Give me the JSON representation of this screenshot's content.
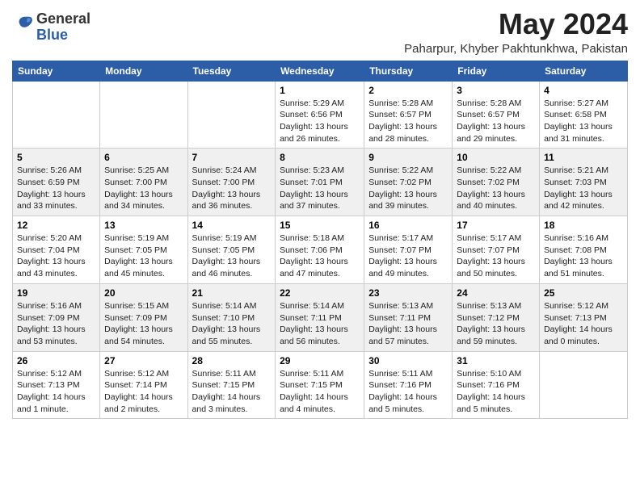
{
  "header": {
    "logo_general": "General",
    "logo_blue": "Blue",
    "month": "May 2024",
    "location": "Paharpur, Khyber Pakhtunkhwa, Pakistan"
  },
  "days_of_week": [
    "Sunday",
    "Monday",
    "Tuesday",
    "Wednesday",
    "Thursday",
    "Friday",
    "Saturday"
  ],
  "weeks": [
    [
      {
        "day": "",
        "info": ""
      },
      {
        "day": "",
        "info": ""
      },
      {
        "day": "",
        "info": ""
      },
      {
        "day": "1",
        "info": "Sunrise: 5:29 AM\nSunset: 6:56 PM\nDaylight: 13 hours\nand 26 minutes."
      },
      {
        "day": "2",
        "info": "Sunrise: 5:28 AM\nSunset: 6:57 PM\nDaylight: 13 hours\nand 28 minutes."
      },
      {
        "day": "3",
        "info": "Sunrise: 5:28 AM\nSunset: 6:57 PM\nDaylight: 13 hours\nand 29 minutes."
      },
      {
        "day": "4",
        "info": "Sunrise: 5:27 AM\nSunset: 6:58 PM\nDaylight: 13 hours\nand 31 minutes."
      }
    ],
    [
      {
        "day": "5",
        "info": "Sunrise: 5:26 AM\nSunset: 6:59 PM\nDaylight: 13 hours\nand 33 minutes."
      },
      {
        "day": "6",
        "info": "Sunrise: 5:25 AM\nSunset: 7:00 PM\nDaylight: 13 hours\nand 34 minutes."
      },
      {
        "day": "7",
        "info": "Sunrise: 5:24 AM\nSunset: 7:00 PM\nDaylight: 13 hours\nand 36 minutes."
      },
      {
        "day": "8",
        "info": "Sunrise: 5:23 AM\nSunset: 7:01 PM\nDaylight: 13 hours\nand 37 minutes."
      },
      {
        "day": "9",
        "info": "Sunrise: 5:22 AM\nSunset: 7:02 PM\nDaylight: 13 hours\nand 39 minutes."
      },
      {
        "day": "10",
        "info": "Sunrise: 5:22 AM\nSunset: 7:02 PM\nDaylight: 13 hours\nand 40 minutes."
      },
      {
        "day": "11",
        "info": "Sunrise: 5:21 AM\nSunset: 7:03 PM\nDaylight: 13 hours\nand 42 minutes."
      }
    ],
    [
      {
        "day": "12",
        "info": "Sunrise: 5:20 AM\nSunset: 7:04 PM\nDaylight: 13 hours\nand 43 minutes."
      },
      {
        "day": "13",
        "info": "Sunrise: 5:19 AM\nSunset: 7:05 PM\nDaylight: 13 hours\nand 45 minutes."
      },
      {
        "day": "14",
        "info": "Sunrise: 5:19 AM\nSunset: 7:05 PM\nDaylight: 13 hours\nand 46 minutes."
      },
      {
        "day": "15",
        "info": "Sunrise: 5:18 AM\nSunset: 7:06 PM\nDaylight: 13 hours\nand 47 minutes."
      },
      {
        "day": "16",
        "info": "Sunrise: 5:17 AM\nSunset: 7:07 PM\nDaylight: 13 hours\nand 49 minutes."
      },
      {
        "day": "17",
        "info": "Sunrise: 5:17 AM\nSunset: 7:07 PM\nDaylight: 13 hours\nand 50 minutes."
      },
      {
        "day": "18",
        "info": "Sunrise: 5:16 AM\nSunset: 7:08 PM\nDaylight: 13 hours\nand 51 minutes."
      }
    ],
    [
      {
        "day": "19",
        "info": "Sunrise: 5:16 AM\nSunset: 7:09 PM\nDaylight: 13 hours\nand 53 minutes."
      },
      {
        "day": "20",
        "info": "Sunrise: 5:15 AM\nSunset: 7:09 PM\nDaylight: 13 hours\nand 54 minutes."
      },
      {
        "day": "21",
        "info": "Sunrise: 5:14 AM\nSunset: 7:10 PM\nDaylight: 13 hours\nand 55 minutes."
      },
      {
        "day": "22",
        "info": "Sunrise: 5:14 AM\nSunset: 7:11 PM\nDaylight: 13 hours\nand 56 minutes."
      },
      {
        "day": "23",
        "info": "Sunrise: 5:13 AM\nSunset: 7:11 PM\nDaylight: 13 hours\nand 57 minutes."
      },
      {
        "day": "24",
        "info": "Sunrise: 5:13 AM\nSunset: 7:12 PM\nDaylight: 13 hours\nand 59 minutes."
      },
      {
        "day": "25",
        "info": "Sunrise: 5:12 AM\nSunset: 7:13 PM\nDaylight: 14 hours\nand 0 minutes."
      }
    ],
    [
      {
        "day": "26",
        "info": "Sunrise: 5:12 AM\nSunset: 7:13 PM\nDaylight: 14 hours\nand 1 minute."
      },
      {
        "day": "27",
        "info": "Sunrise: 5:12 AM\nSunset: 7:14 PM\nDaylight: 14 hours\nand 2 minutes."
      },
      {
        "day": "28",
        "info": "Sunrise: 5:11 AM\nSunset: 7:15 PM\nDaylight: 14 hours\nand 3 minutes."
      },
      {
        "day": "29",
        "info": "Sunrise: 5:11 AM\nSunset: 7:15 PM\nDaylight: 14 hours\nand 4 minutes."
      },
      {
        "day": "30",
        "info": "Sunrise: 5:11 AM\nSunset: 7:16 PM\nDaylight: 14 hours\nand 5 minutes."
      },
      {
        "day": "31",
        "info": "Sunrise: 5:10 AM\nSunset: 7:16 PM\nDaylight: 14 hours\nand 5 minutes."
      },
      {
        "day": "",
        "info": ""
      }
    ]
  ]
}
